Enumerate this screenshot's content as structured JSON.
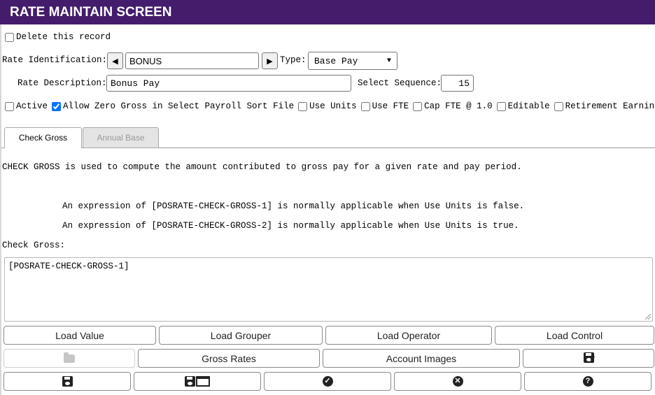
{
  "header": {
    "title": "RATE MAINTAIN SCREEN"
  },
  "record": {
    "delete_label": "Delete this record",
    "delete_checked": false
  },
  "rate": {
    "id_label": "Rate Identification:",
    "id_value": "BONUS",
    "type_label": "Type:",
    "type_value": "Base Pay",
    "desc_label": "Rate Description:",
    "desc_value": "Bonus Pay",
    "seq_label": "Select Sequence:",
    "seq_value": "15"
  },
  "flags": [
    {
      "label": "Active",
      "checked": false
    },
    {
      "label": "Allow Zero Gross in Select Payroll Sort File",
      "checked": true
    },
    {
      "label": "Use Units",
      "checked": false
    },
    {
      "label": "Use FTE",
      "checked": false
    },
    {
      "label": "Cap FTE @ 1.0",
      "checked": false
    },
    {
      "label": "Editable",
      "checked": false
    },
    {
      "label": "Retirement Earnings",
      "checked": false
    }
  ],
  "tabs": [
    {
      "label": "Check Gross",
      "active": true
    },
    {
      "label": "Annual Base",
      "active": false
    }
  ],
  "check_gross": {
    "description": "CHECK GROSS is used to compute the amount contributed to gross pay for a given rate and pay period.",
    "hint1": "An expression of [POSRATE-CHECK-GROSS-1] is normally applicable when Use Units is false.",
    "hint2": "An expression of [POSRATE-CHECK-GROSS-2] is normally applicable when Use Units is true.",
    "field_label": "Check Gross:",
    "value": "[POSRATE-CHECK-GROSS-1]"
  },
  "buttons": {
    "load_value": "Load Value",
    "load_grouper": "Load Grouper",
    "load_operator": "Load Operator",
    "load_control": "Load Control",
    "gross_rates": "Gross Rates",
    "account_images": "Account Images"
  },
  "icons": {
    "prev": "prev-arrow-icon",
    "next": "next-arrow-icon",
    "folder": "folder-icon",
    "save_check": "save-check-icon",
    "save": "save-icon",
    "save_window": "save-window-icon",
    "ok": "check-circle-icon",
    "cancel": "times-circle-icon",
    "help": "question-circle-icon"
  },
  "colors": {
    "header_bg": "#431c6b",
    "header_fg": "#ffffff"
  }
}
